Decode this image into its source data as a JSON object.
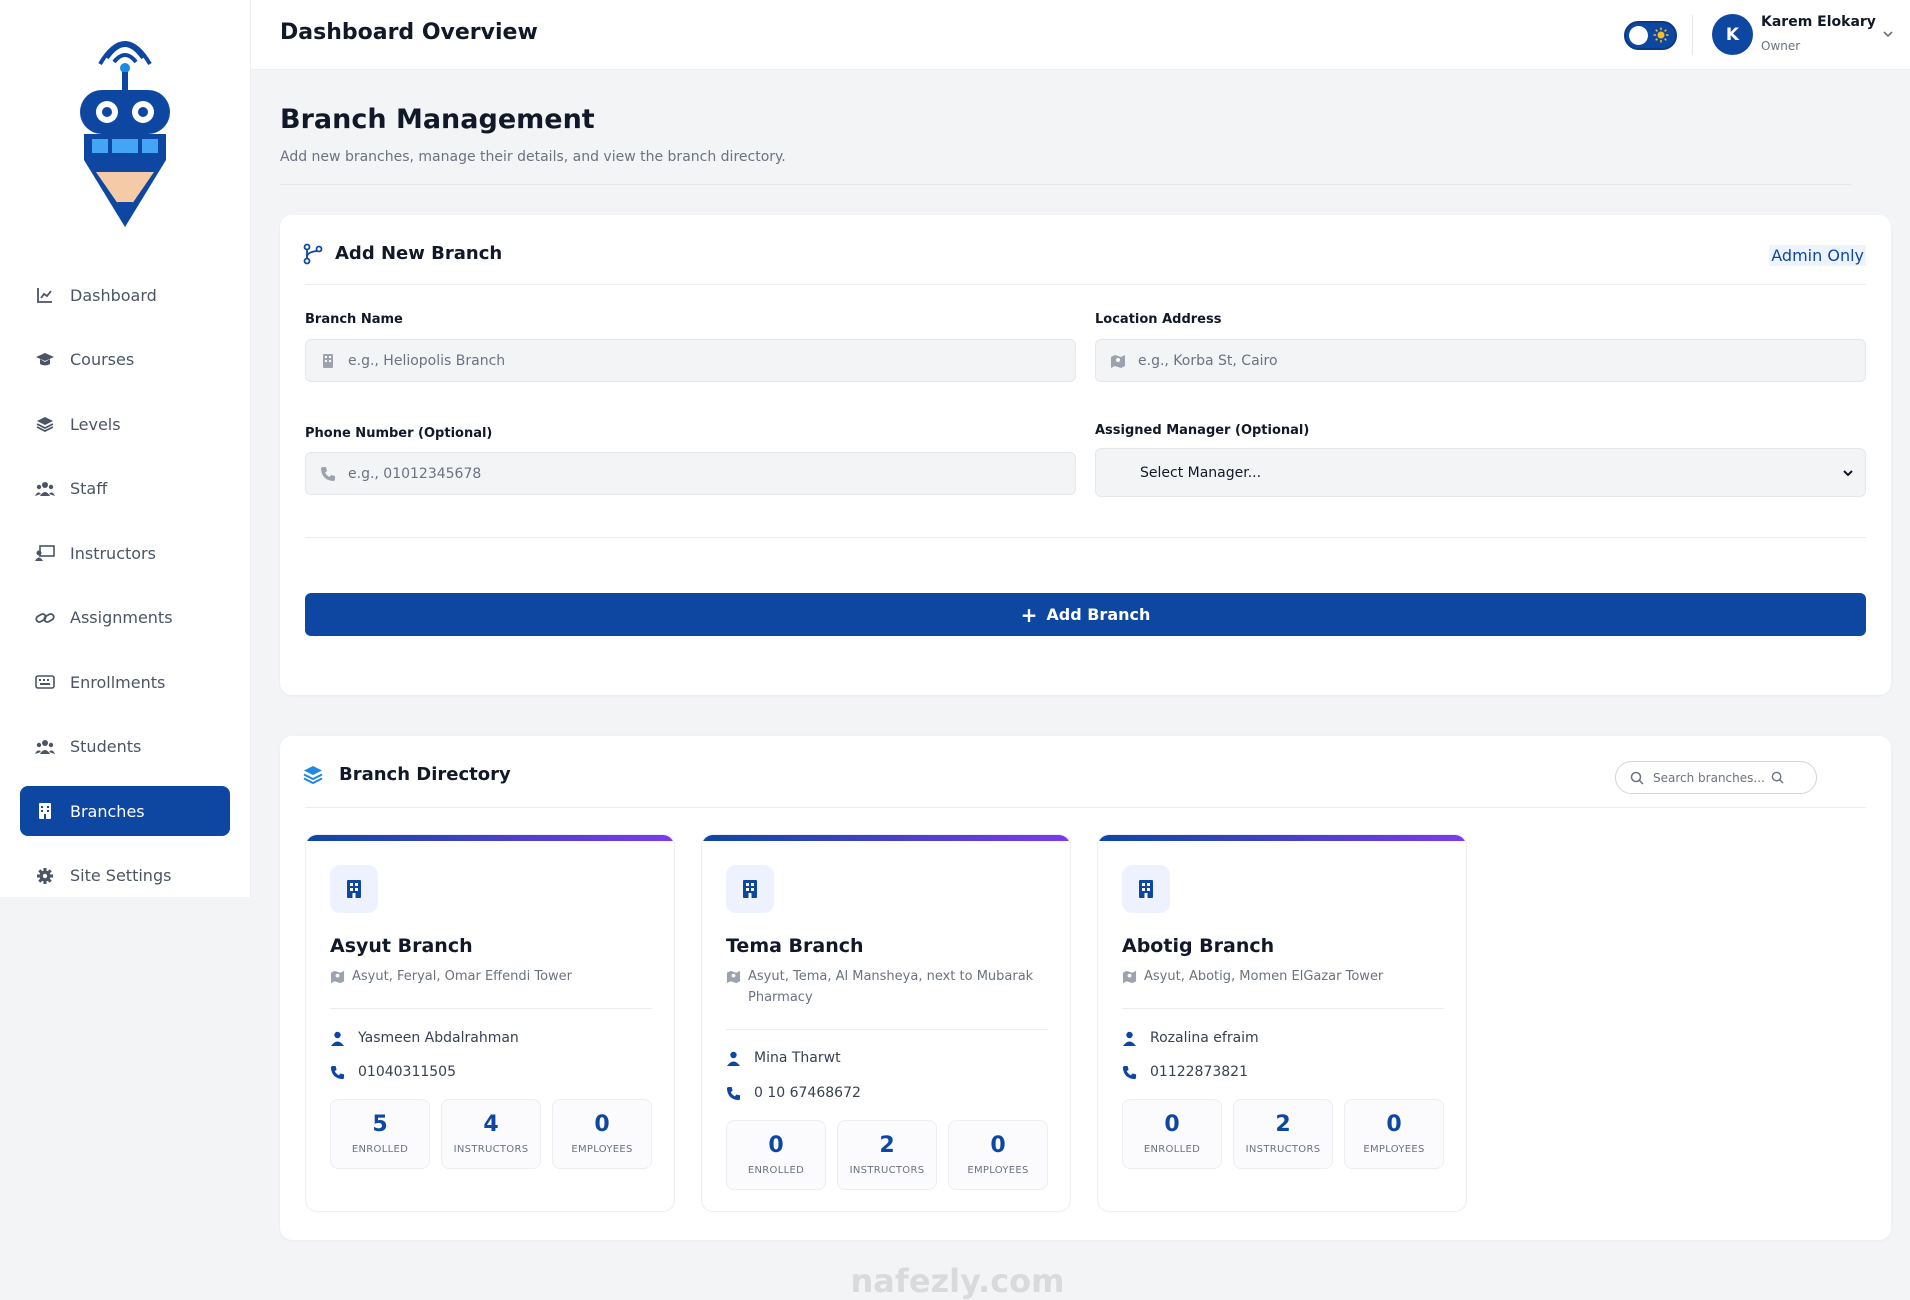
{
  "header": {
    "title": "Dashboard Overview",
    "user_name": "Karem Elokary",
    "user_role": "Owner",
    "avatar_initial": "K"
  },
  "sidebar": {
    "items": [
      {
        "label": "Dashboard",
        "icon": "chart-line-icon",
        "active": false
      },
      {
        "label": "Courses",
        "icon": "graduation-cap-icon",
        "active": false
      },
      {
        "label": "Levels",
        "icon": "layers-icon",
        "active": false
      },
      {
        "label": "Staff",
        "icon": "users-icon",
        "active": false
      },
      {
        "label": "Instructors",
        "icon": "chalkboard-teacher-icon",
        "active": false
      },
      {
        "label": "Assignments",
        "icon": "link-icon",
        "active": false
      },
      {
        "label": "Enrollments",
        "icon": "keyboard-icon",
        "active": false
      },
      {
        "label": "Students",
        "icon": "users-icon",
        "active": false
      },
      {
        "label": "Branches",
        "icon": "building-icon",
        "active": true
      },
      {
        "label": "Site Settings",
        "icon": "gear-icon",
        "active": false
      }
    ]
  },
  "page": {
    "title": "Branch Management",
    "subtitle": "Add new branches, manage their details, and view the branch directory."
  },
  "add_branch": {
    "title": "Add New Branch",
    "badge": "Admin Only",
    "branch_name": {
      "label": "Branch Name",
      "placeholder": "e.g., Heliopolis Branch",
      "value": ""
    },
    "location": {
      "label": "Location Address",
      "placeholder": "e.g., Korba St, Cairo",
      "value": ""
    },
    "phone": {
      "label": "Phone Number (Optional)",
      "placeholder": "e.g., 01012345678",
      "value": ""
    },
    "manager": {
      "label": "Assigned Manager (Optional)",
      "selected": "Select Manager..."
    },
    "submit_label": "Add Branch"
  },
  "directory": {
    "title": "Branch Directory",
    "search_placeholder": "Search branches...",
    "branches": [
      {
        "name": "Asyut Branch",
        "address": "Asyut, Feryal, Omar Effendi Tower",
        "manager": "Yasmeen Abdalrahman",
        "phone": "01040311505",
        "enrolled": "5",
        "instructors": "4",
        "employees": "0"
      },
      {
        "name": "Tema Branch",
        "address": "Asyut, Tema, Al Mansheya, next to Mubarak Pharmacy",
        "manager": "Mina Tharwt",
        "phone": "0 10 67468672",
        "enrolled": "0",
        "instructors": "2",
        "employees": "0"
      },
      {
        "name": "Abotig Branch",
        "address": "Asyut, Abotig, Momen ElGazar Tower",
        "manager": "Rozalina efraim",
        "phone": "01122873821",
        "enrolled": "0",
        "instructors": "2",
        "employees": "0"
      }
    ],
    "stat_labels": {
      "enrolled": "ENROLLED",
      "instructors": "INSTRUCTORS",
      "employees": "EMPLOYEES"
    }
  },
  "watermark": "nafezly.com",
  "colors": {
    "primary": "#0d47a1",
    "accent_gradient_end": "#7c3aed",
    "background": "#f3f4f6"
  }
}
